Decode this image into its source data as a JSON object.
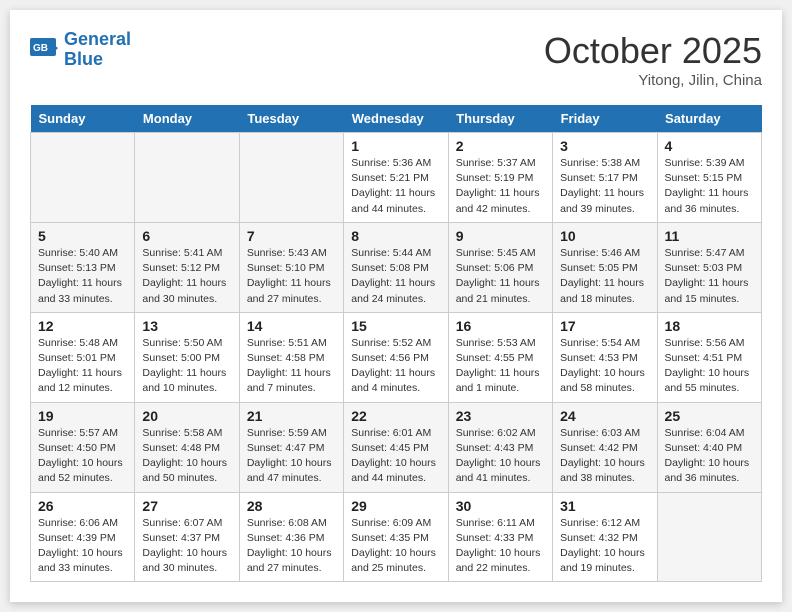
{
  "header": {
    "logo_line1": "General",
    "logo_line2": "Blue",
    "month": "October 2025",
    "location": "Yitong, Jilin, China"
  },
  "weekdays": [
    "Sunday",
    "Monday",
    "Tuesday",
    "Wednesday",
    "Thursday",
    "Friday",
    "Saturday"
  ],
  "weeks": [
    [
      {
        "day": "",
        "empty": true
      },
      {
        "day": "",
        "empty": true
      },
      {
        "day": "",
        "empty": true
      },
      {
        "day": "1",
        "sunrise": "5:36 AM",
        "sunset": "5:21 PM",
        "daylight": "11 hours and 44 minutes."
      },
      {
        "day": "2",
        "sunrise": "5:37 AM",
        "sunset": "5:19 PM",
        "daylight": "11 hours and 42 minutes."
      },
      {
        "day": "3",
        "sunrise": "5:38 AM",
        "sunset": "5:17 PM",
        "daylight": "11 hours and 39 minutes."
      },
      {
        "day": "4",
        "sunrise": "5:39 AM",
        "sunset": "5:15 PM",
        "daylight": "11 hours and 36 minutes."
      }
    ],
    [
      {
        "day": "5",
        "sunrise": "5:40 AM",
        "sunset": "5:13 PM",
        "daylight": "11 hours and 33 minutes."
      },
      {
        "day": "6",
        "sunrise": "5:41 AM",
        "sunset": "5:12 PM",
        "daylight": "11 hours and 30 minutes."
      },
      {
        "day": "7",
        "sunrise": "5:43 AM",
        "sunset": "5:10 PM",
        "daylight": "11 hours and 27 minutes."
      },
      {
        "day": "8",
        "sunrise": "5:44 AM",
        "sunset": "5:08 PM",
        "daylight": "11 hours and 24 minutes."
      },
      {
        "day": "9",
        "sunrise": "5:45 AM",
        "sunset": "5:06 PM",
        "daylight": "11 hours and 21 minutes."
      },
      {
        "day": "10",
        "sunrise": "5:46 AM",
        "sunset": "5:05 PM",
        "daylight": "11 hours and 18 minutes."
      },
      {
        "day": "11",
        "sunrise": "5:47 AM",
        "sunset": "5:03 PM",
        "daylight": "11 hours and 15 minutes."
      }
    ],
    [
      {
        "day": "12",
        "sunrise": "5:48 AM",
        "sunset": "5:01 PM",
        "daylight": "11 hours and 12 minutes."
      },
      {
        "day": "13",
        "sunrise": "5:50 AM",
        "sunset": "5:00 PM",
        "daylight": "11 hours and 10 minutes."
      },
      {
        "day": "14",
        "sunrise": "5:51 AM",
        "sunset": "4:58 PM",
        "daylight": "11 hours and 7 minutes."
      },
      {
        "day": "15",
        "sunrise": "5:52 AM",
        "sunset": "4:56 PM",
        "daylight": "11 hours and 4 minutes."
      },
      {
        "day": "16",
        "sunrise": "5:53 AM",
        "sunset": "4:55 PM",
        "daylight": "11 hours and 1 minute."
      },
      {
        "day": "17",
        "sunrise": "5:54 AM",
        "sunset": "4:53 PM",
        "daylight": "10 hours and 58 minutes."
      },
      {
        "day": "18",
        "sunrise": "5:56 AM",
        "sunset": "4:51 PM",
        "daylight": "10 hours and 55 minutes."
      }
    ],
    [
      {
        "day": "19",
        "sunrise": "5:57 AM",
        "sunset": "4:50 PM",
        "daylight": "10 hours and 52 minutes."
      },
      {
        "day": "20",
        "sunrise": "5:58 AM",
        "sunset": "4:48 PM",
        "daylight": "10 hours and 50 minutes."
      },
      {
        "day": "21",
        "sunrise": "5:59 AM",
        "sunset": "4:47 PM",
        "daylight": "10 hours and 47 minutes."
      },
      {
        "day": "22",
        "sunrise": "6:01 AM",
        "sunset": "4:45 PM",
        "daylight": "10 hours and 44 minutes."
      },
      {
        "day": "23",
        "sunrise": "6:02 AM",
        "sunset": "4:43 PM",
        "daylight": "10 hours and 41 minutes."
      },
      {
        "day": "24",
        "sunrise": "6:03 AM",
        "sunset": "4:42 PM",
        "daylight": "10 hours and 38 minutes."
      },
      {
        "day": "25",
        "sunrise": "6:04 AM",
        "sunset": "4:40 PM",
        "daylight": "10 hours and 36 minutes."
      }
    ],
    [
      {
        "day": "26",
        "sunrise": "6:06 AM",
        "sunset": "4:39 PM",
        "daylight": "10 hours and 33 minutes."
      },
      {
        "day": "27",
        "sunrise": "6:07 AM",
        "sunset": "4:37 PM",
        "daylight": "10 hours and 30 minutes."
      },
      {
        "day": "28",
        "sunrise": "6:08 AM",
        "sunset": "4:36 PM",
        "daylight": "10 hours and 27 minutes."
      },
      {
        "day": "29",
        "sunrise": "6:09 AM",
        "sunset": "4:35 PM",
        "daylight": "10 hours and 25 minutes."
      },
      {
        "day": "30",
        "sunrise": "6:11 AM",
        "sunset": "4:33 PM",
        "daylight": "10 hours and 22 minutes."
      },
      {
        "day": "31",
        "sunrise": "6:12 AM",
        "sunset": "4:32 PM",
        "daylight": "10 hours and 19 minutes."
      },
      {
        "day": "",
        "empty": true
      }
    ]
  ]
}
